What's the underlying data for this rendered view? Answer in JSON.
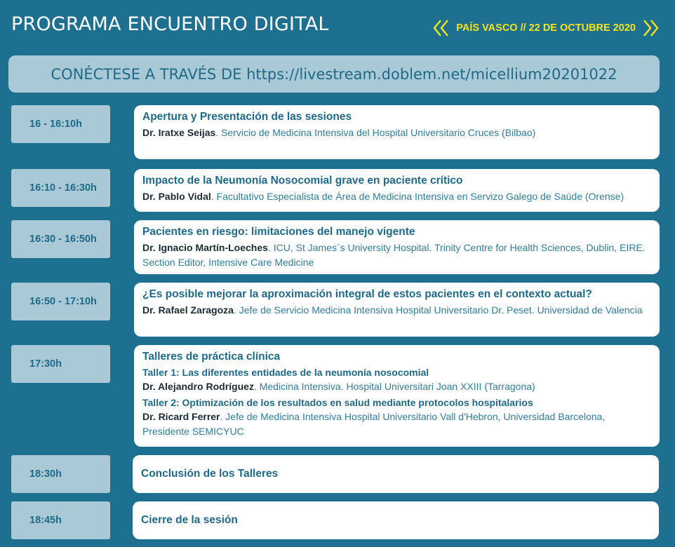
{
  "header": {
    "title": "PROGRAMA ENCUENTRO DIGITAL",
    "meta": "PAÍS VASCO // 22 DE OCTUBRE 2020",
    "accent_color": "#f2e41c",
    "left_icon": "double-chevron-left-icon",
    "right_icon": "double-chevron-right-icon"
  },
  "banner": {
    "text": "CONÉCTESE A TRAVÉS DE https://livestream.doblem.net/micellium20201022"
  },
  "colors": {
    "background": "#1e7090",
    "time_box": "#a8c9d5",
    "card": "#ffffff",
    "heading": "#1e6a88"
  },
  "sessions": [
    {
      "time": "16 - 16:10h",
      "title": "Apertura y Presentación de las sesiones",
      "speaker": "Dr. Iratxe Seijas",
      "affiliation": ". Servicio de Medicina Intensiva del Hospital Universitario Cruces (Bilbao)"
    },
    {
      "time": "16:10 - 16:30h",
      "title": "Impacto de la Neumonía Nosocomial grave en paciente crítico",
      "speaker": "Dr. Pablo Vidal",
      "affiliation": ". Facultativo Especialista de Área de Medicina Intensiva en Servizo Galego de Saúde (Orense)"
    },
    {
      "time": "16:30 - 16:50h",
      "title": "Pacientes en riesgo: limitaciones del manejo vigente",
      "speaker": "Dr. Ignacio Martín-Loeches",
      "affiliation": ". ICU, St James´s University Hospital. Trinity Centre for Health Sciences, Dublin, EIRE.",
      "affiliation_2": "Section Editor, Intensive Care Medicine"
    },
    {
      "time": "16:50 - 17:10h",
      "title": "¿Es posible mejorar la aproximación integral de estos pacientes en el contexto actual?",
      "speaker": "Dr. Rafael Zaragoza",
      "affiliation": ". Jefe de Servicio Medicina Intensiva Hospital Universitario Dr. Peset. Universidad de Valencia"
    },
    {
      "time": "17:30h",
      "title": "Talleres de práctica clínica",
      "workshop1_title": "Taller 1: Las diferentes entidades de la neumonía nosocomial",
      "workshop1_speaker": "Dr. Alejandro Rodríguez",
      "workshop1_affiliation": ". Medicina Intensiva. Hospital Universitari Joan XXIII (Tarragona)",
      "workshop2_title": "Taller 2: Optimización de los resultados en salud mediante protocolos hospitalarios",
      "workshop2_speaker": "Dr. Ricard Ferrer",
      "workshop2_affiliation": ". Jefe de Medicina Intensiva Hospital Universitario Vall d'Hebron, Universidad Barcelona,",
      "workshop2_affiliation_2": "Presidente SEMICYUC"
    },
    {
      "time": "18:30h",
      "title": "Conclusión de los Talleres"
    },
    {
      "time": "18:45h",
      "title": "Cierre de la sesión"
    }
  ]
}
